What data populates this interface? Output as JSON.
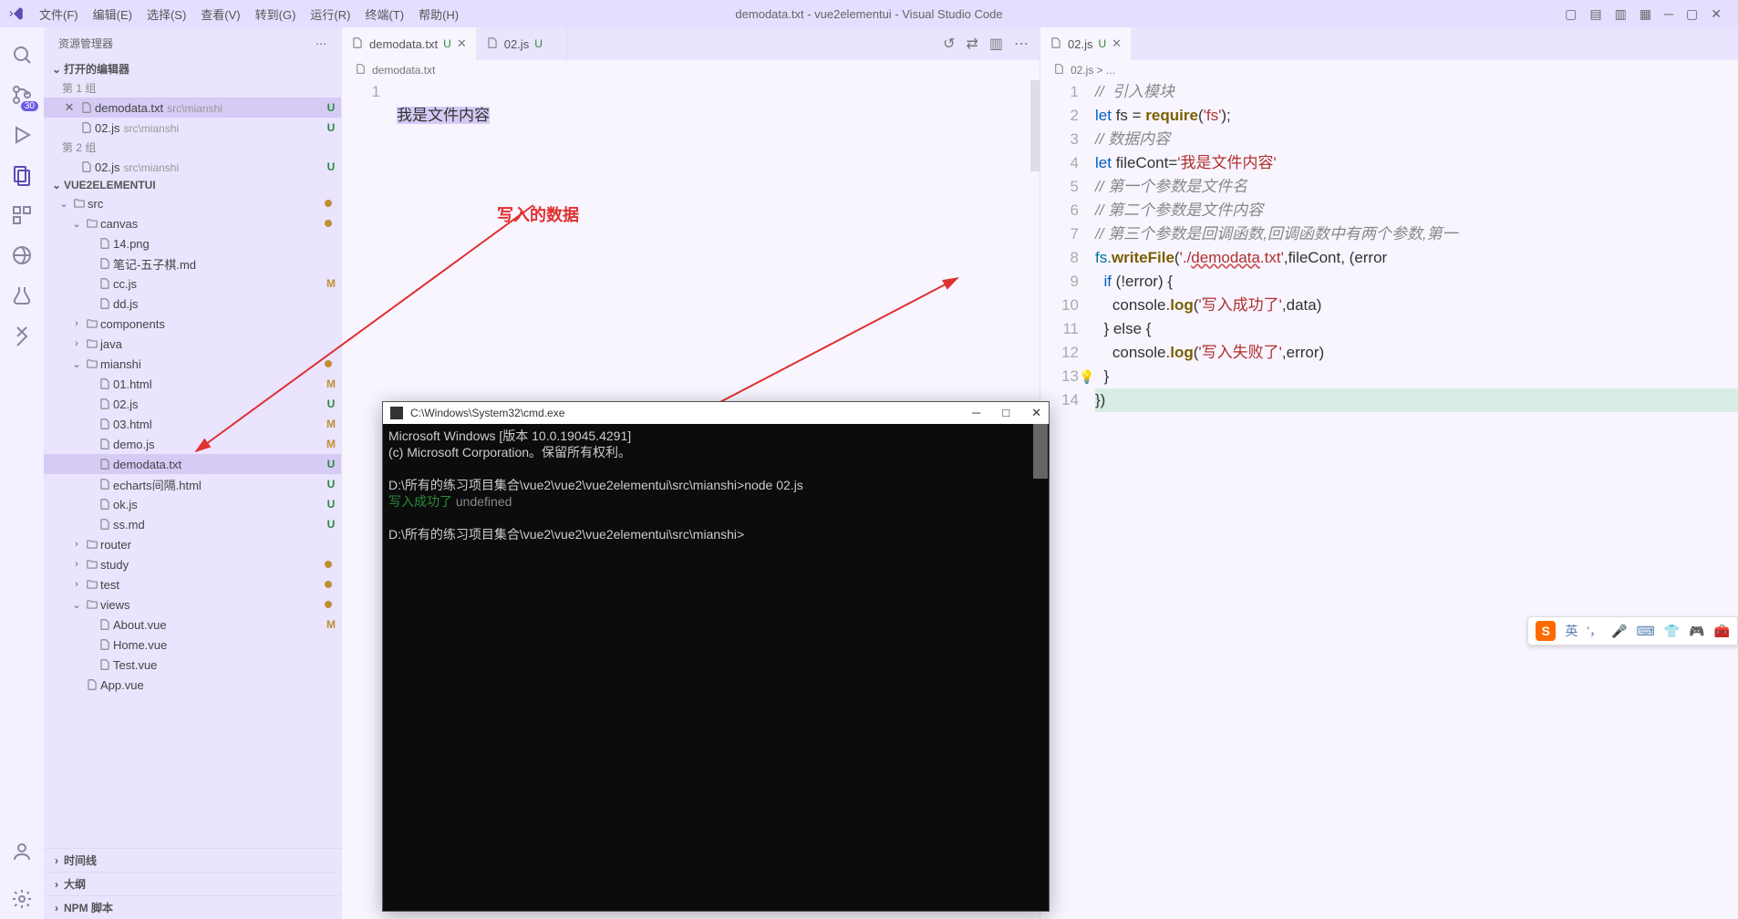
{
  "title": "demodata.txt - vue2elementui - Visual Studio Code",
  "menubar": [
    "文件(F)",
    "编辑(E)",
    "选择(S)",
    "查看(V)",
    "转到(G)",
    "运行(R)",
    "终端(T)",
    "帮助(H)"
  ],
  "activity_badge": "30",
  "sidebar": {
    "title": "资源管理器",
    "open_editors": "打开的编辑器",
    "group1": "第 1 组",
    "group2": "第 2 组",
    "oe": [
      {
        "name": "demodata.txt",
        "sub": "src\\mianshi",
        "mark": "U",
        "close": true,
        "active": true
      },
      {
        "name": "02.js",
        "sub": "src\\mianshi",
        "mark": "U"
      }
    ],
    "oe2": [
      {
        "name": "02.js",
        "sub": "src\\mianshi",
        "mark": "U"
      }
    ],
    "project": "VUE2ELEMENTUI",
    "tree": [
      {
        "d": 1,
        "chev": "v",
        "folder": true,
        "name": "src",
        "dot": "M"
      },
      {
        "d": 2,
        "chev": "v",
        "folder": true,
        "name": "canvas",
        "dot": "M"
      },
      {
        "d": 3,
        "file": true,
        "name": "14.png"
      },
      {
        "d": 3,
        "file": true,
        "name": "笔记-五子棋.md"
      },
      {
        "d": 3,
        "file": true,
        "name": "cc.js",
        "mark": "M"
      },
      {
        "d": 3,
        "file": true,
        "name": "dd.js"
      },
      {
        "d": 2,
        "chev": ">",
        "folder": true,
        "name": "components"
      },
      {
        "d": 2,
        "chev": ">",
        "folder": true,
        "name": "java"
      },
      {
        "d": 2,
        "chev": "v",
        "folder": true,
        "name": "mianshi",
        "dot": "M"
      },
      {
        "d": 3,
        "file": true,
        "name": "01.html",
        "mark": "M"
      },
      {
        "d": 3,
        "file": true,
        "name": "02.js",
        "mark": "U"
      },
      {
        "d": 3,
        "file": true,
        "name": "03.html",
        "mark": "M"
      },
      {
        "d": 3,
        "file": true,
        "name": "demo.js",
        "mark": "M"
      },
      {
        "d": 3,
        "file": true,
        "name": "demodata.txt",
        "mark": "U",
        "active": true
      },
      {
        "d": 3,
        "file": true,
        "name": "echarts间隔.html",
        "mark": "U"
      },
      {
        "d": 3,
        "file": true,
        "name": "ok.js",
        "mark": "U"
      },
      {
        "d": 3,
        "file": true,
        "name": "ss.md",
        "mark": "U"
      },
      {
        "d": 2,
        "chev": ">",
        "folder": true,
        "name": "router"
      },
      {
        "d": 2,
        "chev": ">",
        "folder": true,
        "name": "study",
        "dot": "M"
      },
      {
        "d": 2,
        "chev": ">",
        "folder": true,
        "name": "test",
        "dot": "M"
      },
      {
        "d": 2,
        "chev": "v",
        "folder": true,
        "name": "views",
        "dot": "M"
      },
      {
        "d": 3,
        "file": true,
        "name": "About.vue",
        "mark": "M"
      },
      {
        "d": 3,
        "file": true,
        "name": "Home.vue"
      },
      {
        "d": 3,
        "file": true,
        "name": "Test.vue"
      },
      {
        "d": 2,
        "file": true,
        "name": "App.vue"
      }
    ],
    "bottom": [
      "时间线",
      "大纲",
      "NPM 脚本"
    ]
  },
  "editor1": {
    "tabs": [
      {
        "name": "demodata.txt",
        "st": "U",
        "active": true,
        "close": true
      },
      {
        "name": "02.js",
        "st": "U"
      }
    ],
    "crumb": "demodata.txt",
    "lines": [
      "1"
    ],
    "content": "我是文件内容",
    "annotation": "写入的数据"
  },
  "editor2": {
    "tabs": [
      {
        "name": "02.js",
        "st": "U",
        "active": true,
        "close": true
      }
    ],
    "crumb": "02.js > ...",
    "gutter": [
      "1",
      "2",
      "3",
      "4",
      "5",
      "6",
      "7",
      "8",
      "9",
      "10",
      "11",
      "12",
      "13",
      "14"
    ],
    "code": {
      "l1": "//  引入模块",
      "l2_a": "let",
      "l2_b": " fs = ",
      "l2_c": "require",
      "l2_d": "(",
      "l2_e": "'fs'",
      "l2_f": ");",
      "l3": "// 数据内容",
      "l4_a": "let",
      "l4_b": " fileCont=",
      "l4_c": "'我是文件内容'",
      "l5": "// 第一个参数是文件名",
      "l6": "// 第二个参数是文件内容",
      "l7": "// 第三个参数是回调函数,回调函数中有两个参数,第一",
      "l8_a": "fs.",
      "l8_b": "writeFile",
      "l8_c": "(",
      "l8_d": "'./",
      "l8_e": "demodata",
      "l8_f": ".txt'",
      "l8_g": ",fileCont, (error",
      "l9_a": "  if",
      "l9_b": " (!error) {",
      "l10_a": "    console.",
      "l10_b": "log",
      "l10_c": "(",
      "l10_d": "'写入成功了'",
      "l10_e": ",data)",
      "l11": "  } else {",
      "l12_a": "    console.",
      "l12_b": "log",
      "l12_c": "(",
      "l12_d": "'写入失败了'",
      "l12_e": ",error)",
      "l13": "  }",
      "l14": "})"
    }
  },
  "terminal": {
    "title": "C:\\Windows\\System32\\cmd.exe",
    "lines": {
      "a": "Microsoft Windows [版本 10.0.19045.4291]",
      "b": "(c) Microsoft Corporation。保留所有权利。",
      "c": "D:\\所有的练习项目集合\\vue2\\vue2\\vue2elementui\\src\\mianshi>node 02.js",
      "d1": "写入成功了",
      "d2": " undefined",
      "e": "D:\\所有的练习项目集合\\vue2\\vue2\\vue2elementui\\src\\mianshi>"
    }
  },
  "ime": {
    "lang": "英"
  }
}
